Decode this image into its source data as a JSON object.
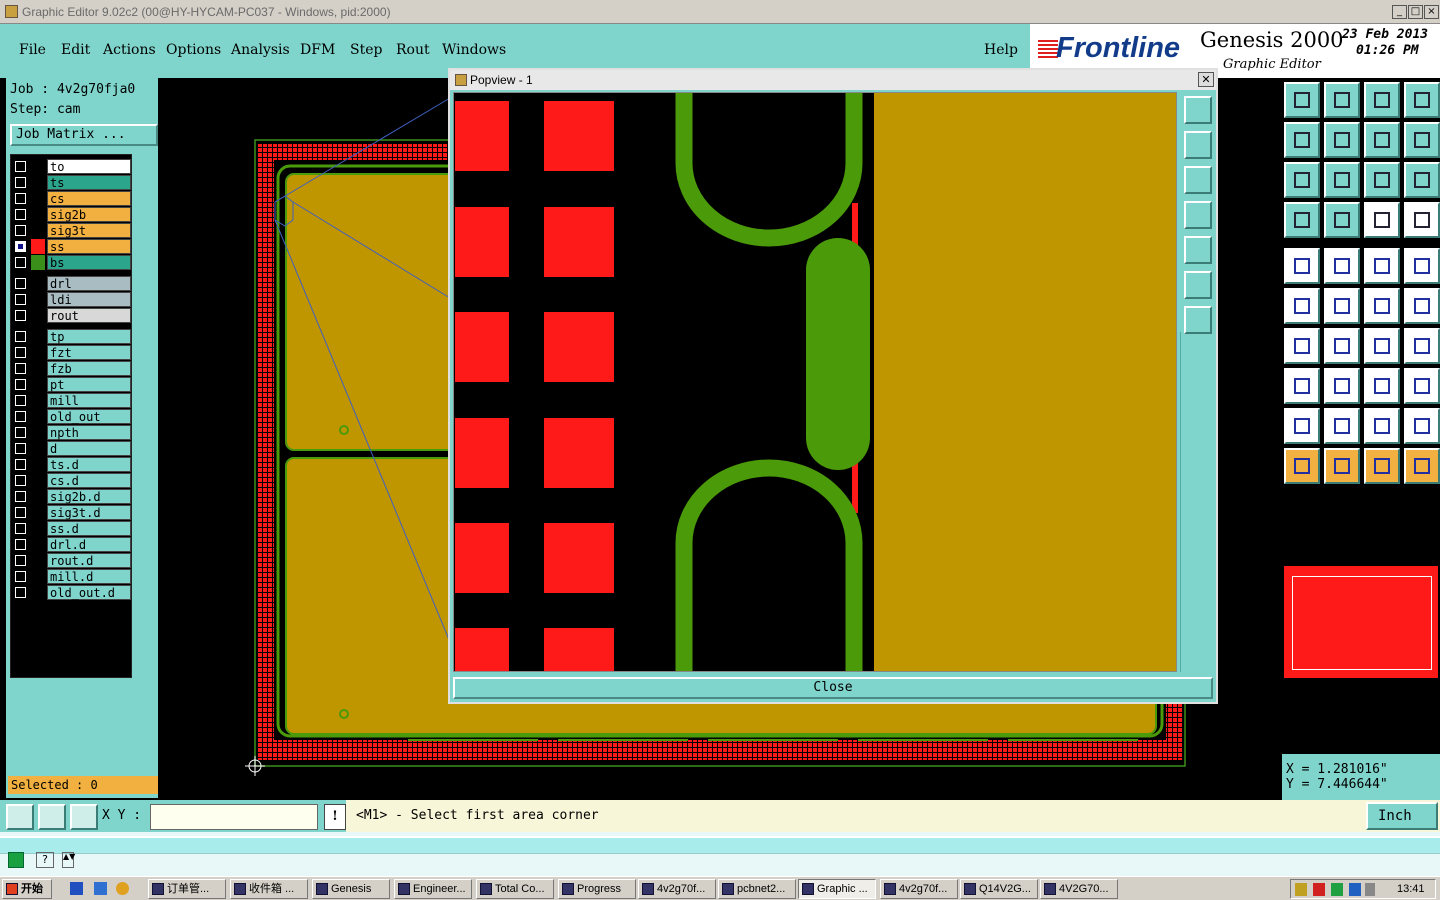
{
  "window": {
    "title": "Graphic Editor 9.02c2 (00@HY-HYCAM-PC037 - Windows, pid:2000)"
  },
  "menu": [
    "File",
    "Edit",
    "Actions",
    "Options",
    "Analysis",
    "DFM",
    "Step",
    "Rout",
    "Windows"
  ],
  "help_label": "Help",
  "logo": {
    "brand": "Frontline",
    "product": "Genesis 2000",
    "subtitle": "Graphic Editor",
    "date": "23 Feb 2013",
    "time": "01:26 PM"
  },
  "job": {
    "job_line": "Job : 4v2g70fja0",
    "step_line": "Step: cam",
    "matrix_button": "Job Matrix ..."
  },
  "layers_group1": [
    {
      "name": "to",
      "color": "#ffffff"
    },
    {
      "name": "ts",
      "color": "#2ca58d"
    },
    {
      "name": "cs",
      "color": "#f2b040"
    },
    {
      "name": "sig2b",
      "color": "#f2b040"
    },
    {
      "name": "sig3t",
      "color": "#f2b040"
    },
    {
      "name": "ss",
      "color": "#f2b040",
      "swatch": "#ff1a1a",
      "active": true
    },
    {
      "name": "bs",
      "color": "#2ca58d",
      "swatch": "#3a8f1a"
    }
  ],
  "layers_group2": [
    {
      "name": "drl",
      "color": "#a9bcc2"
    },
    {
      "name": "ldi",
      "color": "#a9bcc2"
    },
    {
      "name": "rout",
      "color": "#d8d8d8"
    }
  ],
  "layers_group3": [
    {
      "name": "tp",
      "color": "#7fd5cc"
    },
    {
      "name": "fzt",
      "color": "#7fd5cc"
    },
    {
      "name": "fzb",
      "color": "#7fd5cc"
    },
    {
      "name": "pt",
      "color": "#7fd5cc"
    },
    {
      "name": "mill",
      "color": "#7fd5cc"
    },
    {
      "name": "old_out",
      "color": "#7fd5cc"
    },
    {
      "name": "npth",
      "color": "#7fd5cc"
    },
    {
      "name": "d",
      "color": "#7fd5cc"
    },
    {
      "name": "ts.d",
      "color": "#7fd5cc"
    },
    {
      "name": "cs.d",
      "color": "#7fd5cc"
    },
    {
      "name": "sig2b.d",
      "color": "#7fd5cc"
    },
    {
      "name": "sig3t.d",
      "color": "#7fd5cc"
    },
    {
      "name": "ss.d",
      "color": "#7fd5cc"
    },
    {
      "name": "drl.d",
      "color": "#7fd5cc"
    },
    {
      "name": "rout.d",
      "color": "#7fd5cc"
    },
    {
      "name": "mill.d",
      "color": "#7fd5cc"
    },
    {
      "name": "old_out.d",
      "color": "#7fd5cc"
    }
  ],
  "selected": "Selected : 0",
  "popview": {
    "title": "Popview - 1",
    "close_label": "Close"
  },
  "coords": {
    "x": "X = 1.281016\"",
    "y": "Y = 7.446644\""
  },
  "command": {
    "xy_label": "X Y :",
    "prompt": "<M1> - Select first area corner",
    "units": "Inch"
  },
  "taskbar": {
    "start": "开始",
    "tasks": [
      "订单管...",
      "收件箱 ...",
      "Genesis",
      "Engineer...",
      "Total Co...",
      "Progress",
      "4v2g70f...",
      "pcbnet2...",
      "Graphic ...",
      "4v2g70f...",
      "Q14V2G...",
      "4V2G70..."
    ],
    "clock": "13:41"
  },
  "colors": {
    "teal": "#7fd5cc",
    "copper": "#bf9500",
    "mask": "#4a9a0a",
    "pad": "#ff1a1a"
  }
}
